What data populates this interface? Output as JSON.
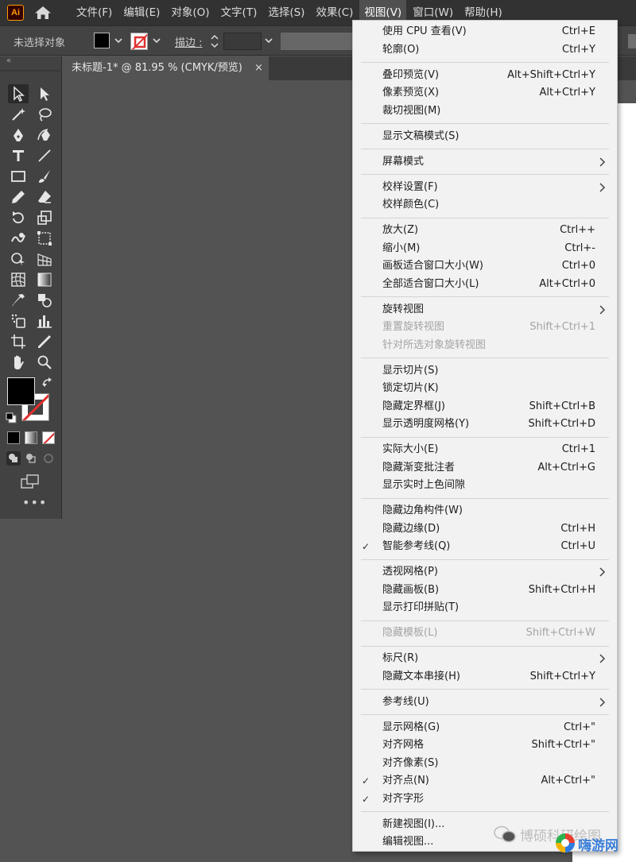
{
  "app": {
    "logo_text": "Ai"
  },
  "menubar": {
    "items": [
      "文件(F)",
      "编辑(E)",
      "对象(O)",
      "文字(T)",
      "选择(S)",
      "效果(C)",
      "视图(V)",
      "窗口(W)",
      "帮助(H)"
    ],
    "active_item": "视图(V)"
  },
  "controlbar": {
    "selection_status": "未选择对象",
    "stroke_label": "描边 :",
    "fill_color": "#000000"
  },
  "document": {
    "tab_title": "未标题-1* @ 81.95 % (CMYK/预览)",
    "close_glyph": "×"
  },
  "view_menu": {
    "groups": [
      [
        {
          "label": "使用 CPU 查看(V)",
          "shortcut": "Ctrl+E"
        },
        {
          "label": "轮廓(O)",
          "shortcut": "Ctrl+Y"
        }
      ],
      [
        {
          "label": "叠印预览(V)",
          "shortcut": "Alt+Shift+Ctrl+Y"
        },
        {
          "label": "像素预览(X)",
          "shortcut": "Alt+Ctrl+Y"
        },
        {
          "label": "裁切视图(M)",
          "shortcut": ""
        }
      ],
      [
        {
          "label": "显示文稿模式(S)",
          "shortcut": ""
        }
      ],
      [
        {
          "label": "屏幕模式",
          "shortcut": "",
          "submenu": true
        }
      ],
      [
        {
          "label": "校样设置(F)",
          "shortcut": "",
          "submenu": true
        },
        {
          "label": "校样颜色(C)",
          "shortcut": ""
        }
      ],
      [
        {
          "label": "放大(Z)",
          "shortcut": "Ctrl++"
        },
        {
          "label": "缩小(M)",
          "shortcut": "Ctrl+-"
        },
        {
          "label": "画板适合窗口大小(W)",
          "shortcut": "Ctrl+0"
        },
        {
          "label": "全部适合窗口大小(L)",
          "shortcut": "Alt+Ctrl+0"
        }
      ],
      [
        {
          "label": "旋转视图",
          "shortcut": "",
          "submenu": true
        },
        {
          "label": "重置旋转视图",
          "shortcut": "Shift+Ctrl+1",
          "disabled": true
        },
        {
          "label": "针对所选对象旋转视图",
          "shortcut": "",
          "disabled": true
        }
      ],
      [
        {
          "label": "显示切片(S)",
          "shortcut": ""
        },
        {
          "label": "锁定切片(K)",
          "shortcut": ""
        },
        {
          "label": "隐藏定界框(J)",
          "shortcut": "Shift+Ctrl+B"
        },
        {
          "label": "显示透明度网格(Y)",
          "shortcut": "Shift+Ctrl+D"
        }
      ],
      [
        {
          "label": "实际大小(E)",
          "shortcut": "Ctrl+1"
        },
        {
          "label": "隐藏渐变批注者",
          "shortcut": "Alt+Ctrl+G"
        },
        {
          "label": "显示实时上色间隙",
          "shortcut": ""
        }
      ],
      [
        {
          "label": "隐藏边角构件(W)",
          "shortcut": ""
        },
        {
          "label": "隐藏边缘(D)",
          "shortcut": "Ctrl+H"
        },
        {
          "label": "智能参考线(Q)",
          "shortcut": "Ctrl+U",
          "checked": true
        }
      ],
      [
        {
          "label": "透视网格(P)",
          "shortcut": "",
          "submenu": true
        },
        {
          "label": "隐藏画板(B)",
          "shortcut": "Shift+Ctrl+H"
        },
        {
          "label": "显示打印拼贴(T)",
          "shortcut": ""
        }
      ],
      [
        {
          "label": "隐藏模板(L)",
          "shortcut": "Shift+Ctrl+W",
          "disabled": true
        }
      ],
      [
        {
          "label": "标尺(R)",
          "shortcut": "",
          "submenu": true
        },
        {
          "label": "隐藏文本串接(H)",
          "shortcut": "Shift+Ctrl+Y"
        }
      ],
      [
        {
          "label": "参考线(U)",
          "shortcut": "",
          "submenu": true
        }
      ],
      [
        {
          "label": "显示网格(G)",
          "shortcut": "Ctrl+\""
        },
        {
          "label": "对齐网格",
          "shortcut": "Shift+Ctrl+\""
        },
        {
          "label": "对齐像素(S)",
          "shortcut": ""
        },
        {
          "label": "对齐点(N)",
          "shortcut": "Alt+Ctrl+\"",
          "checked": true
        },
        {
          "label": "对齐字形",
          "shortcut": "",
          "checked": true
        }
      ],
      [
        {
          "label": "新建视图(I)...",
          "shortcut": ""
        },
        {
          "label": "编辑视图...",
          "shortcut": ""
        }
      ]
    ]
  },
  "watermark": {
    "text": "博硕科研绘图",
    "site": "嗨游网"
  }
}
